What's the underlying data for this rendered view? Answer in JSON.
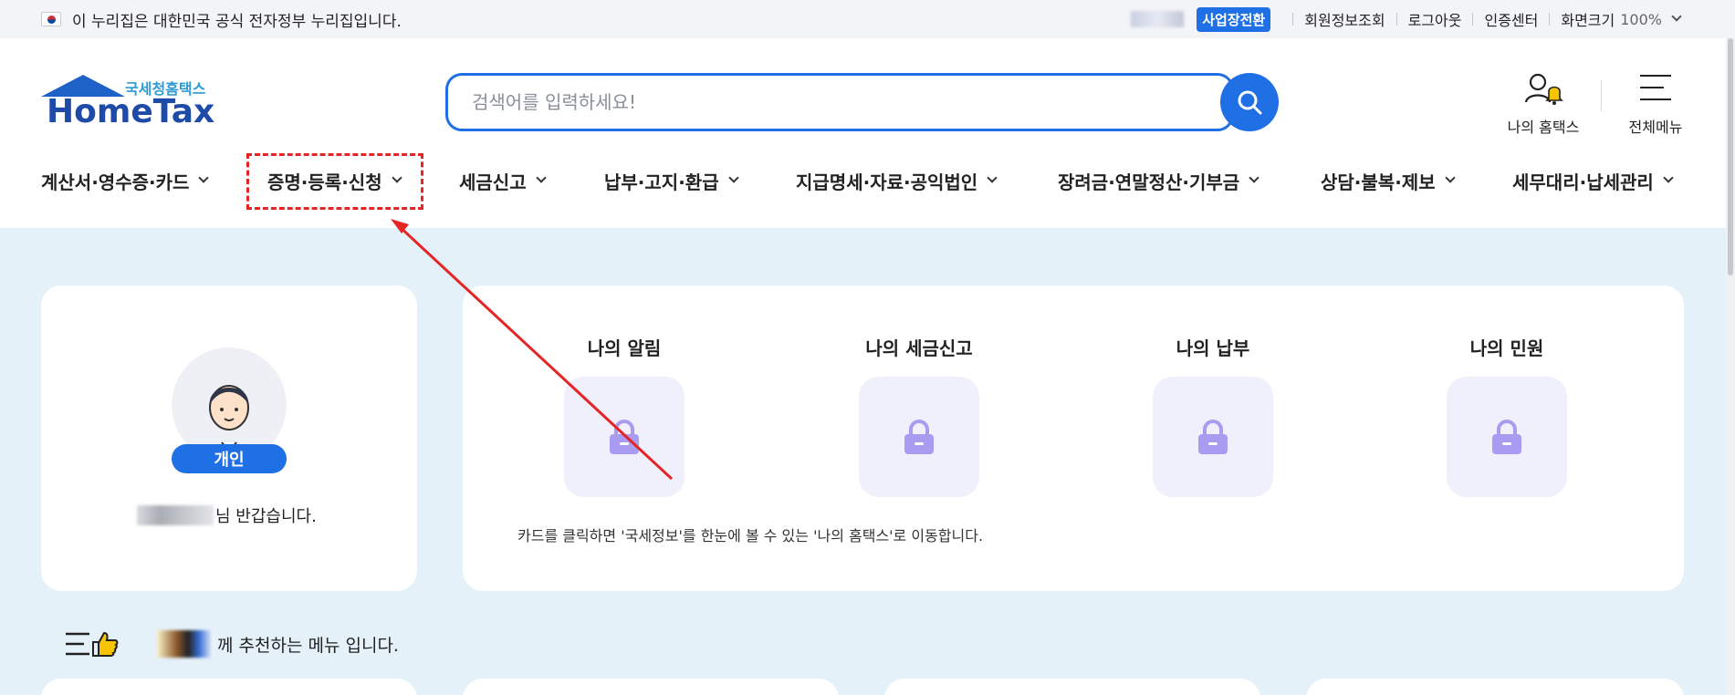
{
  "gov_banner": {
    "flag_icon": "korea-flag-icon",
    "text": "이 누리집은 대한민국 공식 전자정부 누리집입니다."
  },
  "utility_nav": {
    "business_switch": "사업장전환",
    "member_info": "회원정보조회",
    "logout": "로그아웃",
    "cert_center": "인증센터",
    "zoom_label": "화면크기",
    "zoom_value": "100%"
  },
  "logo": {
    "sub": "국세청홈택스",
    "main": "HomeTax"
  },
  "search": {
    "placeholder": "검색어를 입력하세요!",
    "value": ""
  },
  "header_actions": {
    "my_hometax": "나의 홈택스",
    "all_menu": "전체메뉴"
  },
  "nav": {
    "items": [
      {
        "label": "계산서·영수증·카드"
      },
      {
        "label": "증명·등록·신청"
      },
      {
        "label": "세금신고"
      },
      {
        "label": "납부·고지·환급"
      },
      {
        "label": "지급명세·자료·공익법인"
      },
      {
        "label": "장려금·연말정산·기부금"
      },
      {
        "label": "상담·불복·제보"
      },
      {
        "label": "세무대리·납세관리"
      }
    ]
  },
  "profile": {
    "badge": "개인",
    "greeting_suffix": "님 반갑습니다."
  },
  "my_cards": {
    "tiles": [
      {
        "title": "나의 알림",
        "icon": "lock-icon"
      },
      {
        "title": "나의 세금신고",
        "icon": "lock-icon"
      },
      {
        "title": "나의 납부",
        "icon": "lock-icon"
      },
      {
        "title": "나의 민원",
        "icon": "lock-icon"
      }
    ],
    "note": "카드를 클릭하면 '국세정보'를 한눈에 볼 수 있는 '나의 홈택스'로 이동합니다."
  },
  "recommend": {
    "icon": "menu-thumbs-up-icon",
    "suffix": "께 추천하는 메뉴 입니다."
  },
  "colors": {
    "primary": "#1f6fe5",
    "content_bg": "#e5f1f9",
    "annotation": "#e52525",
    "tile_bg": "#f0effc",
    "lock": "#a99cf0"
  }
}
